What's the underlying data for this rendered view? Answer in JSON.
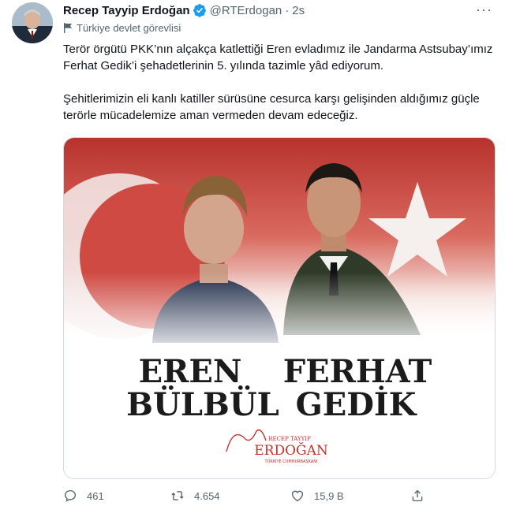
{
  "author": {
    "name": "Recep Tayyip Erdoğan",
    "handle": "@RTErdogan",
    "separator": "·",
    "time": "2s",
    "label": "Türkiye devlet görevlisi"
  },
  "tweet": {
    "paragraph1": "Terör örgütü PKK’nın alçakça katlettiği Eren evladımız ile Jandarma Astsubay’ımız Ferhat Gedik’i şehadetlerinin 5. yılında tazimle yâd ediyorum.",
    "paragraph2": "Şehitlerimizin eli kanlı katiller sürüsüne cesurca karşı gelişinden aldığımız güçle terörle mücadelemize aman vermeden devam edeceğiz."
  },
  "media": {
    "name_left_line1": "EREN",
    "name_left_line2": "BÜLBÜL",
    "name_right_line1": "FERHAT",
    "name_right_line2": "GEDİK",
    "signature_top": "RECEP TAYYIP",
    "signature_main": "ERDOĞAN",
    "signature_bottom": "TÜRKİYE CUMHURBAŞKANI"
  },
  "actions": {
    "reply_count": "461",
    "retweet_count": "4.654",
    "like_count": "15,9 B"
  },
  "colors": {
    "accent": "#1d9bf0",
    "flag_red": "#c8302c",
    "text_secondary": "#536471"
  },
  "icons": [
    "verified-badge-icon",
    "more-options-icon",
    "government-flag-icon",
    "reply-icon",
    "retweet-icon",
    "like-icon",
    "share-icon"
  ]
}
